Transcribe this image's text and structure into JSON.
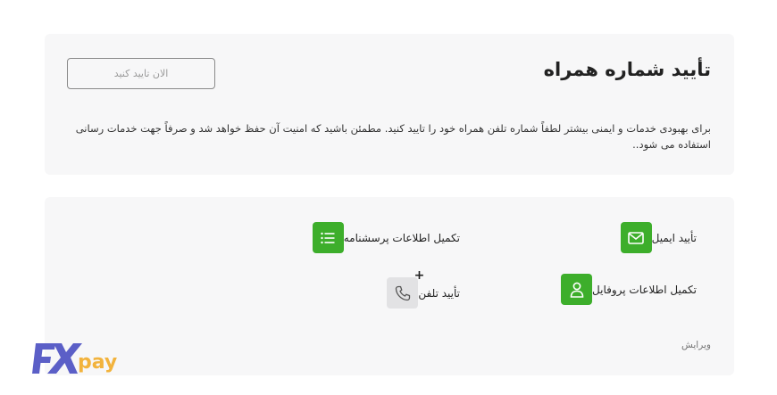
{
  "verify_phone": {
    "title": "تأیید شماره همراه",
    "button_label": "الان تایید کنید",
    "description": "برای بهبودی خدمات و ایمنی بیشتر لطفاً شماره تلفن همراه خود را تایید کنید. مطمئن باشید که امنیت آن حفظ خواهد شد و صرفاً جهت خدمات رسانی استفاده می شود.."
  },
  "tasks": {
    "email_label": "تأیید ایمیل",
    "survey_label": "تکمیل اطلاعات پرسشنامه",
    "profile_label": "تکمیل اطلاعات پروفایل",
    "phone_label": "تأیید تلفن",
    "phone_badge": "+",
    "edit_label": "ویرایش"
  },
  "logo": {
    "text_fx": "FX",
    "text_pay": "pay",
    "colors": {
      "fx": "#5b5fc7",
      "pay": "#f2b33d"
    }
  },
  "colors": {
    "accent_green": "#3dae2b",
    "card_bg": "#f7f7f8"
  }
}
